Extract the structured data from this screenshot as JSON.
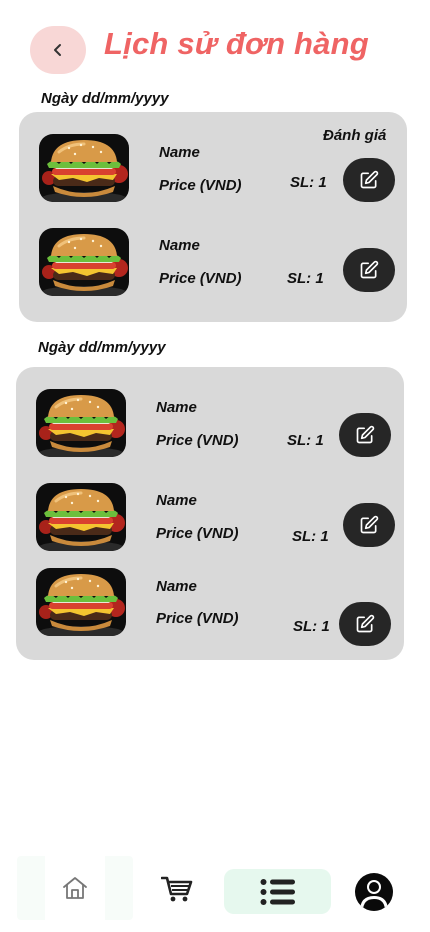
{
  "header": {
    "title": "Lịch sử đơn hàng",
    "back_icon": "chevron-left-icon"
  },
  "colors": {
    "title": "#ef6464",
    "back_bg": "#f8d7d6",
    "card_bg": "#d9d9d9",
    "edit_btn": "#262626",
    "nav_active": "#e6f8ee"
  },
  "orders": [
    {
      "date": "Ngày dd/mm/yyyy",
      "rate_label": "Đánh giá",
      "items": [
        {
          "name": "Name",
          "price": "Price (VND)",
          "qty": "SL: 1",
          "image": "burger-image",
          "action_icon": "edit-icon"
        },
        {
          "name": "Name",
          "price": "Price (VND)",
          "qty": "SL: 1",
          "image": "burger-image",
          "action_icon": "edit-icon"
        }
      ]
    },
    {
      "date": "Ngày dd/mm/yyyy",
      "items": [
        {
          "name": "Name",
          "price": "Price (VND)",
          "qty": "SL: 1",
          "image": "burger-image",
          "action_icon": "edit-icon"
        },
        {
          "name": "Name",
          "price": "Price (VND)",
          "qty": "SL: 1",
          "image": "burger-image",
          "action_icon": "edit-icon"
        },
        {
          "name": "Name",
          "price": "Price (VND)",
          "qty": "SL: 1",
          "image": "burger-image",
          "action_icon": "edit-icon"
        }
      ]
    }
  ],
  "bottom_nav": {
    "active": "orders",
    "items": [
      {
        "id": "home",
        "icon": "home-icon"
      },
      {
        "id": "cart",
        "icon": "cart-icon"
      },
      {
        "id": "orders",
        "icon": "list-icon"
      },
      {
        "id": "profile",
        "icon": "user-icon"
      }
    ]
  }
}
